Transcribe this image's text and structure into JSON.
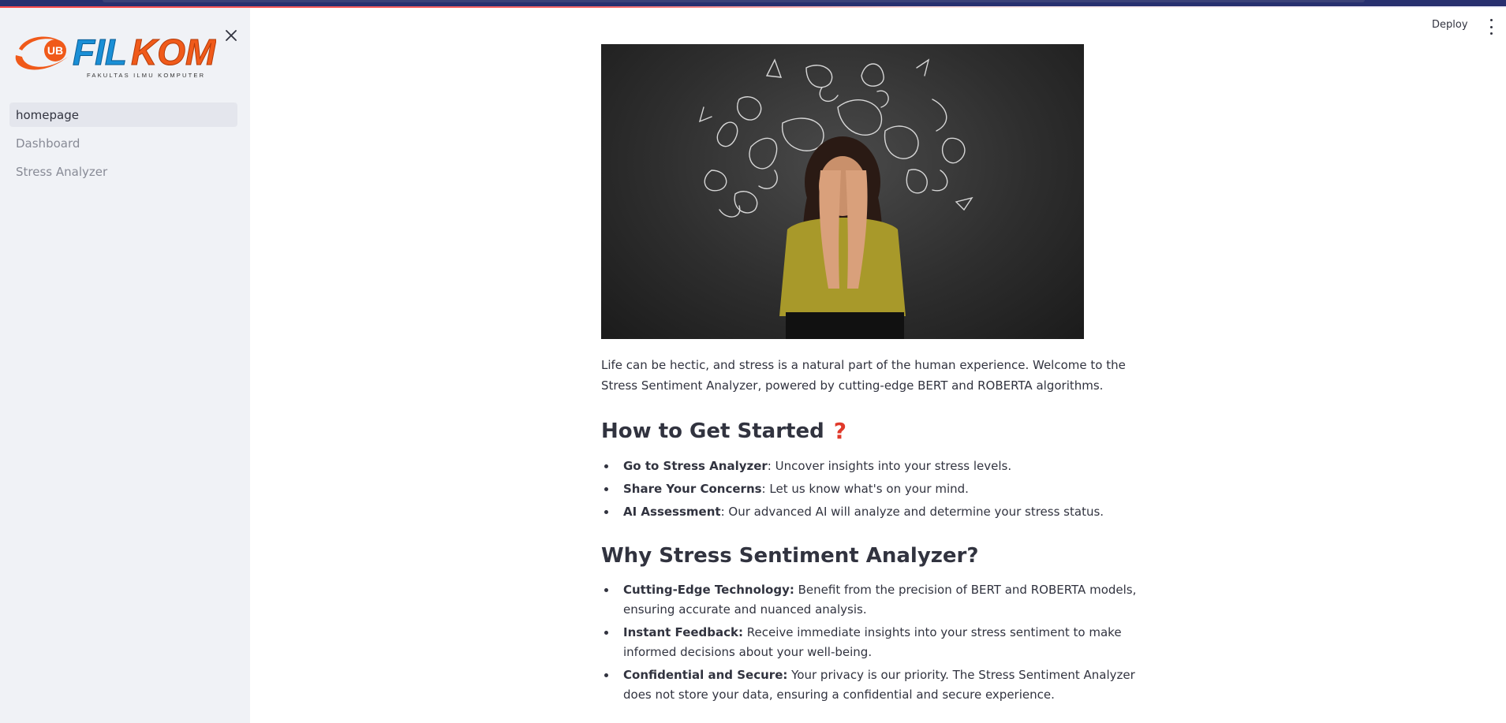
{
  "sidebar": {
    "logo_text": "FILKOM",
    "logo_badge": "UB",
    "logo_subtitle": "FAKULTAS ILMU KOMPUTER",
    "close_icon": "close-icon",
    "nav": [
      {
        "label": "homepage",
        "active": true
      },
      {
        "label": "Dashboard",
        "active": false
      },
      {
        "label": "Stress Analyzer",
        "active": false
      }
    ]
  },
  "header": {
    "deploy_label": "Deploy",
    "menu_icon": "kebab-menu-icon"
  },
  "main": {
    "intro": "Life can be hectic, and stress is a natural part of the human experience. Welcome to the Stress Sentiment Analyzer, powered by cutting-edge BERT and ROBERTA algorithms.",
    "section1": {
      "title": "How to Get Started",
      "icon": "question-mark-icon",
      "items": [
        {
          "bold": "Go to Stress Analyzer",
          "text": ": Uncover insights into your stress levels."
        },
        {
          "bold": "Share Your Concerns",
          "text": ": Let us know what's on your mind."
        },
        {
          "bold": "AI Assessment",
          "text": ": Our advanced AI will analyze and determine your stress status."
        }
      ]
    },
    "section2": {
      "title": "Why Stress Sentiment Analyzer?",
      "items": [
        {
          "bold": "Cutting-Edge Technology:",
          "text": " Benefit from the precision of BERT and ROBERTA models, ensuring accurate and nuanced analysis."
        },
        {
          "bold": "Instant Feedback:",
          "text": " Receive immediate insights into your stress sentiment to make informed decisions about your well-being."
        },
        {
          "bold": "Confidential and Secure:",
          "text": " Your privacy is our priority. The Stress Sentiment Analyzer does not store your data, ensuring a confidential and secure experience."
        }
      ]
    }
  },
  "colors": {
    "sidebar_bg": "#f0f2f6",
    "accent_orange": "#f05a1a",
    "accent_blue": "#1a8fd6",
    "text": "#31333f",
    "question_red": "#e0392a"
  }
}
